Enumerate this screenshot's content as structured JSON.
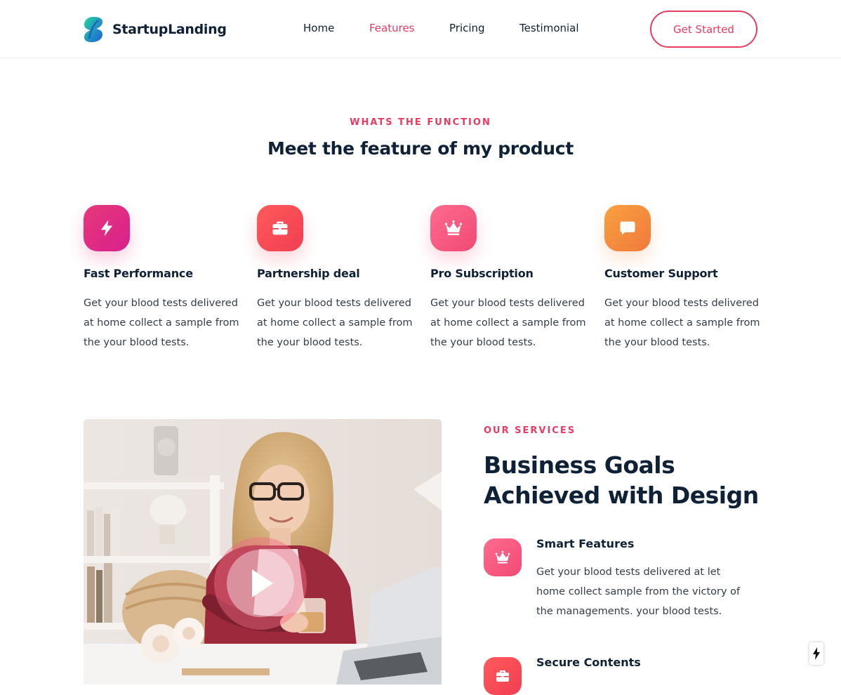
{
  "brand": {
    "name": "StartupLanding"
  },
  "nav": {
    "items": [
      {
        "label": "Home"
      },
      {
        "label": "Features"
      },
      {
        "label": "Pricing"
      },
      {
        "label": "Testimonial"
      }
    ],
    "active": "Features",
    "cta_label": "Get Started"
  },
  "features_section": {
    "eyebrow": "WHATS THE FUNCTION",
    "title": "Meet the feature of my product",
    "items": [
      {
        "icon": "lightning-icon",
        "title": "Fast Performance",
        "desc": "Get your blood tests delivered at home collect a sample from the your blood tests."
      },
      {
        "icon": "briefcase-icon",
        "title": "Partnership deal",
        "desc": "Get your blood tests delivered at home collect a sample from the your blood tests."
      },
      {
        "icon": "crown-icon",
        "title": "Pro Subscription",
        "desc": "Get your blood tests delivered at home collect a sample from the your blood tests."
      },
      {
        "icon": "chat-icon",
        "title": "Customer Support",
        "desc": "Get your blood tests delivered at home collect a sample from the your blood tests."
      }
    ]
  },
  "services_section": {
    "eyebrow": "OUR SERVICES",
    "title_line1": "Business Goals",
    "title_line2": "Achieved with Design",
    "items": [
      {
        "icon": "crown-icon",
        "title": "Smart Features",
        "desc": "Get your blood tests delivered at let home collect sample from the victory of the managements. your blood tests."
      },
      {
        "icon": "briefcase-icon",
        "title": "Secure Contents",
        "desc": ""
      }
    ]
  },
  "colors": {
    "accent": "#ea3a60",
    "heading": "#0f2137",
    "body_text": "#343d48"
  }
}
